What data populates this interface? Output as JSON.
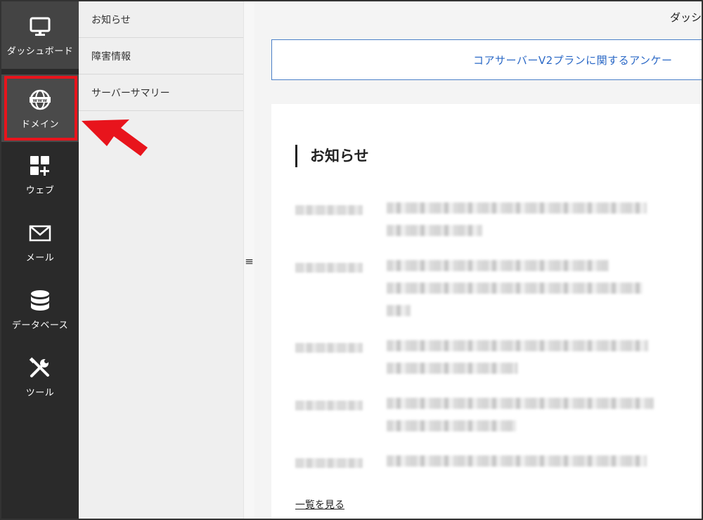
{
  "nav": {
    "items": [
      {
        "label": "ダッシュボード",
        "icon": "monitor-icon"
      },
      {
        "label": "ドメイン",
        "icon": "globe-www-icon"
      },
      {
        "label": "ウェブ",
        "icon": "grid-plus-icon"
      },
      {
        "label": "メール",
        "icon": "envelope-icon"
      },
      {
        "label": "データベース",
        "icon": "database-icon"
      },
      {
        "label": "ツール",
        "icon": "tools-icon"
      }
    ],
    "highlighted": "ドメイン",
    "highlight_color": "#e8141c"
  },
  "submenu": {
    "items": [
      {
        "label": "お知らせ"
      },
      {
        "label": "障害情報"
      },
      {
        "label": "サーバーサマリー"
      }
    ]
  },
  "grip": {
    "icon": "hamburger-icon",
    "glyph": "≡"
  },
  "header": {
    "title": "ダッシ"
  },
  "banner": {
    "text": "コアサーバーV2プランに関するアンケー"
  },
  "notices": {
    "title": "お知らせ",
    "more_link": "一覧を見る"
  },
  "colors": {
    "nav_bg": "#2a2a2a",
    "link": "#2a68c6",
    "arrow": "#e8141c"
  }
}
